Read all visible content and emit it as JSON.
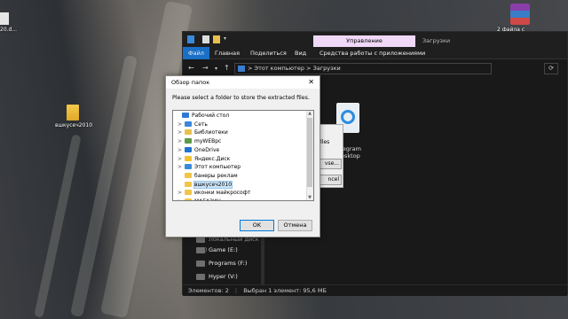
{
  "desktop": {
    "left_label": "20.d...",
    "folder_label": "вшкусеч2010",
    "right_label": "2 файла с"
  },
  "explorer": {
    "context_tab": "Управление",
    "window_title": "Загрузки",
    "ribbon_tabs": [
      "Файл",
      "Главная",
      "Поделиться",
      "Вид",
      "Средства работы с приложениями"
    ],
    "address": [
      "Этот компьютер",
      "Загрузки"
    ],
    "address_sep": ">",
    "content_partial_text": [
      "files",
      "legram",
      "esktop"
    ],
    "nav_lower": [
      "Game (E:)",
      "Programs (F:)",
      "Hyper (V:)"
    ],
    "nav_partial_top": "Локальный диск (D:)",
    "status": {
      "items": "Элементов: 2",
      "selected": "Выбран 1 элемент: 95,6 МБ"
    }
  },
  "extract_dialog": {
    "label_partial": "files",
    "button1": "vse...",
    "button2": "ncel"
  },
  "browse": {
    "title": "Обзор папок",
    "close": "✕",
    "prompt": "Please select a folder to store the extracted files.",
    "ok_label": "OK",
    "cancel_label": "Отмена",
    "tree": [
      {
        "label": "Рабочий стол",
        "expander": "",
        "icon_color": "#2f7ad8",
        "indent": 0
      },
      {
        "label": "Сеть",
        "expander": ">",
        "icon_color": "#3d86d9",
        "indent": 1
      },
      {
        "label": "Библиотеки",
        "expander": ">",
        "icon_color": "#e8c050",
        "indent": 1
      },
      {
        "label": "myWEBpc",
        "expander": ">",
        "icon_color": "#5a9a4a",
        "indent": 1
      },
      {
        "label": "OneDrive",
        "expander": ">",
        "icon_color": "#1e73d0",
        "indent": 1
      },
      {
        "label": "Яндекс.Диск",
        "expander": ">",
        "icon_color": "#f2c230",
        "indent": 1
      },
      {
        "label": "Этот компьютер",
        "expander": ">",
        "icon_color": "#3a8ad9",
        "indent": 1
      },
      {
        "label": "банеры реклам",
        "expander": "",
        "icon_color": "#f0c548",
        "indent": 1
      },
      {
        "label": "вшкусеч2010",
        "expander": "",
        "icon_color": "#f0c548",
        "indent": 1
      },
      {
        "label": "иконки майкрософт",
        "expander": ">",
        "icon_color": "#f0c548",
        "indent": 1
      },
      {
        "label": "МАГАЗИН",
        "expander": ">",
        "icon_color": "#f0c548",
        "indent": 1
      }
    ],
    "selected_index": 8
  }
}
